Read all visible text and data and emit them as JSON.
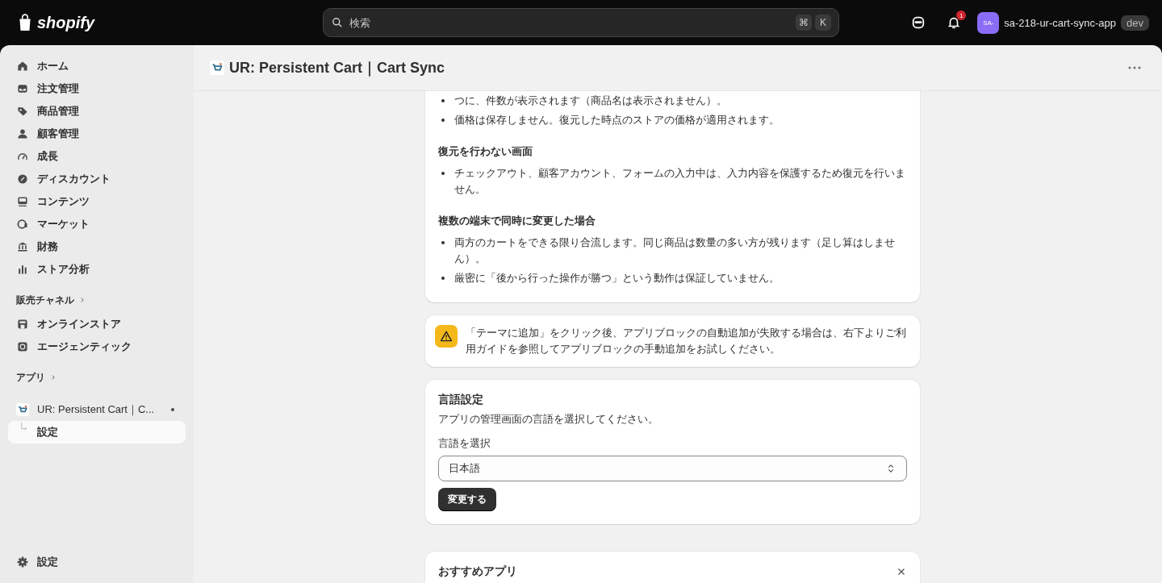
{
  "topbar": {
    "logo_text": "shopify",
    "search": {
      "placeholder": "検索",
      "keys": [
        "⌘",
        "K"
      ]
    },
    "notification_count": "1",
    "avatar": "SA-",
    "store_name": "sa-218-ur-cart-sync-app",
    "badge": "dev"
  },
  "sidebar": {
    "items": [
      {
        "label": "ホーム",
        "selected": false
      },
      {
        "label": "注文管理",
        "selected": false
      },
      {
        "label": "商品管理",
        "selected": false
      },
      {
        "label": "顧客管理",
        "selected": false
      },
      {
        "label": "成長",
        "selected": false
      },
      {
        "label": "ディスカウント",
        "selected": false
      },
      {
        "label": "コンテンツ",
        "selected": false
      },
      {
        "label": "マーケット",
        "selected": false
      },
      {
        "label": "財務",
        "selected": false
      },
      {
        "label": "ストア分析",
        "selected": false
      }
    ],
    "sales_channels": {
      "heading": "販売チャネル",
      "items": [
        {
          "label": "オンラインストア",
          "selected": false
        },
        {
          "label": "エージェンティック",
          "selected": false
        }
      ]
    },
    "apps": {
      "heading": "アプリ",
      "items": [
        {
          "label": "UR: Persistent Cart｜C...",
          "selected": false,
          "children": [
            {
              "label": "設定",
              "selected": true
            }
          ]
        }
      ]
    },
    "footer": {
      "label": "設定",
      "selected": false
    }
  },
  "app_header": {
    "title": "UR: Persistent Cart｜Cart Sync"
  },
  "info_card": {
    "blocks": [
      {
        "kind": "bullets",
        "items": [
          "つに、件数が表示されます（商品名は表示されません）。",
          "価格は保存しません。復元した時点のストアの価格が適用されます。"
        ]
      },
      {
        "kind": "heading",
        "text": "復元を行わない画面"
      },
      {
        "kind": "bullets",
        "items": [
          "チェックアウト、顧客アカウント、フォームの入力中は、入力内容を保護するため復元を行いません。"
        ]
      },
      {
        "kind": "heading",
        "text": "複数の端末で同時に変更した場合"
      },
      {
        "kind": "bullets",
        "items": [
          "両方のカートをできる限り合流します。同じ商品は数量の多い方が残ります（足し算はしません）。",
          "厳密に「後から行った操作が勝つ」という動作は保証していません。"
        ]
      }
    ]
  },
  "warning_banner": {
    "text": "「テーマに追加」をクリック後、アプリブロックの自動追加が失敗する場合は、右下よりご利用ガイドを参照してアプリブロックの手動追加をお試しください。"
  },
  "language_card": {
    "title": "言語設定",
    "description": "アプリの管理画面の言語を選択してください。",
    "select_label": "言語を選択",
    "select_value": "日本語",
    "button": "変更する"
  },
  "recommended_card": {
    "title": "おすすめアプリ"
  }
}
